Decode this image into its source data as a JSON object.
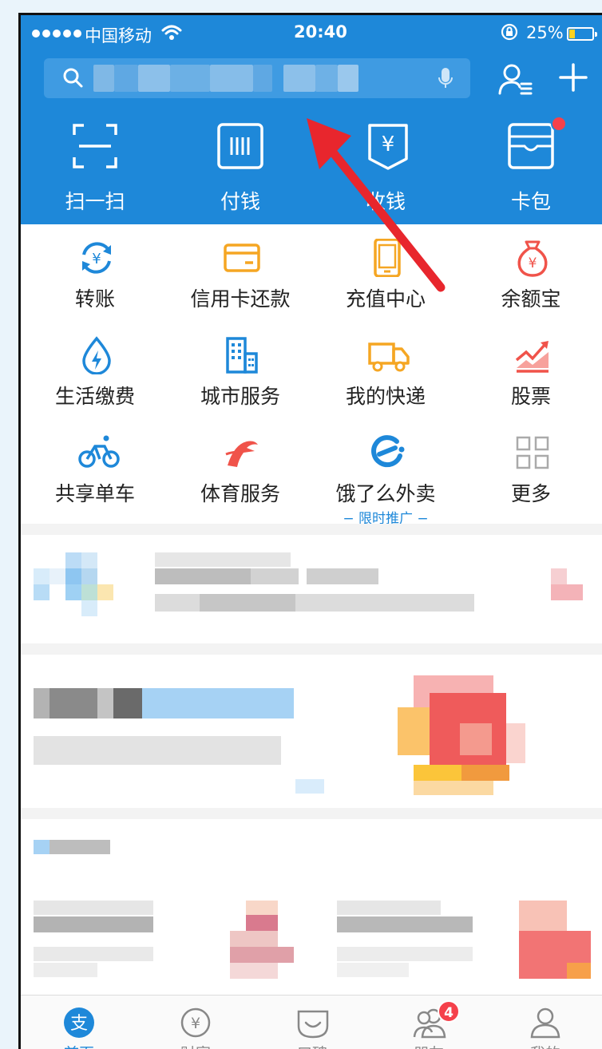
{
  "status_bar": {
    "carrier": "中国移动",
    "time": "20:40",
    "battery": "25%",
    "battery_level": 0.25
  },
  "header": {
    "quick_actions": [
      {
        "label": "扫一扫",
        "icon": "scan-icon"
      },
      {
        "label": "付钱",
        "icon": "barcode-pay-icon"
      },
      {
        "label": "收钱",
        "icon": "receive-money-icon"
      },
      {
        "label": "卡包",
        "icon": "card-wallet-icon"
      }
    ]
  },
  "services": [
    {
      "label": "转账",
      "icon": "transfer-icon",
      "color": "#1e88d9"
    },
    {
      "label": "信用卡还款",
      "icon": "credit-card-icon",
      "color": "#f5a623"
    },
    {
      "label": "充值中心",
      "icon": "phone-recharge-icon",
      "color": "#f5a623"
    },
    {
      "label": "余额宝",
      "icon": "money-bag-icon",
      "color": "#f0534a"
    },
    {
      "label": "生活缴费",
      "icon": "water-drop-icon",
      "color": "#1e88d9"
    },
    {
      "label": "城市服务",
      "icon": "building-icon",
      "color": "#1e88d9"
    },
    {
      "label": "我的快递",
      "icon": "truck-icon",
      "color": "#f5a623"
    },
    {
      "label": "股票",
      "icon": "stock-chart-icon",
      "color": "#f0534a"
    },
    {
      "label": "共享单车",
      "icon": "bicycle-icon",
      "color": "#1e88d9"
    },
    {
      "label": "体育服务",
      "icon": "sports-icon",
      "color": "#f0534a"
    },
    {
      "label": "饿了么外卖",
      "icon": "eleme-icon",
      "color": "#1e88d9",
      "sub": "限时推广"
    },
    {
      "label": "更多",
      "icon": "more-grid-icon",
      "color": "#aaaaaa"
    }
  ],
  "tabs": [
    {
      "label": "首页",
      "icon": "alipay-home-icon",
      "active": true
    },
    {
      "label": "财富",
      "icon": "wealth-icon",
      "active": false
    },
    {
      "label": "口碑",
      "icon": "koubei-icon",
      "active": false
    },
    {
      "label": "朋友",
      "icon": "friends-icon",
      "active": false,
      "badge": "4"
    },
    {
      "label": "我的",
      "icon": "profile-icon",
      "active": false
    }
  ],
  "colors": {
    "brand_blue": "#1e88d9",
    "annotation_red": "#e8262d"
  }
}
